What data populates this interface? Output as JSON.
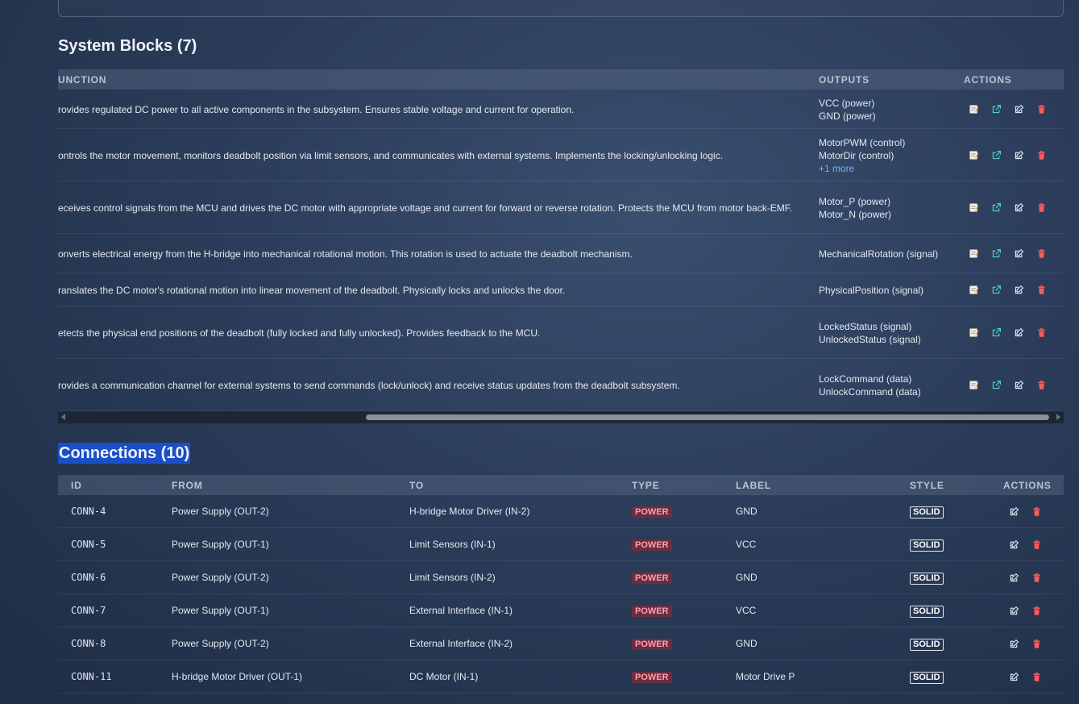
{
  "blocks": {
    "title": "System Blocks (7)",
    "headers": {
      "function": "UNCTION",
      "outputs": "OUTPUTS",
      "actions": "ACTIONS"
    },
    "rows": [
      {
        "function": "rovides regulated DC power to all active components in the subsystem. Ensures stable voltage and current for operation.",
        "outputs": [
          "VCC (power)",
          "GND (power)"
        ],
        "more": ""
      },
      {
        "function": "ontrols the motor movement, monitors deadbolt position via limit sensors, and communicates with external systems. Implements the locking/unlocking logic.",
        "outputs": [
          "MotorPWM (control)",
          "MotorDir (control)"
        ],
        "more": "+1 more"
      },
      {
        "function": "eceives control signals from the MCU and drives the DC motor with appropriate voltage and current for forward or reverse rotation. Protects the MCU from motor back-EMF.",
        "outputs": [
          "Motor_P (power)",
          "Motor_N (power)"
        ],
        "more": ""
      },
      {
        "function": "onverts electrical energy from the H-bridge into mechanical rotational motion. This rotation is used to actuate the deadbolt mechanism.",
        "outputs": [
          "MechanicalRotation (signal)"
        ],
        "more": ""
      },
      {
        "function": "ranslates the DC motor's rotational motion into linear movement of the deadbolt. Physically locks and unlocks the door.",
        "outputs": [
          "PhysicalPosition (signal)"
        ],
        "more": ""
      },
      {
        "function": "etects the physical end positions of the deadbolt (fully locked and fully unlocked). Provides feedback to the MCU.",
        "outputs": [
          "LockedStatus (signal)",
          "UnlockedStatus (signal)"
        ],
        "more": ""
      },
      {
        "function": "rovides a communication channel for external systems to send commands (lock/unlock) and receive status updates from the deadbolt subsystem.",
        "outputs": [
          "LockCommand (data)",
          "UnlockCommand (data)"
        ],
        "more": ""
      }
    ]
  },
  "connections": {
    "title": "Connections (10)",
    "headers": {
      "id": "ID",
      "from": "FROM",
      "to": "TO",
      "type": "TYPE",
      "label": "LABEL",
      "style": "STYLE",
      "actions": "ACTIONS"
    },
    "rows": [
      {
        "id": "CONN-4",
        "from": "Power Supply (OUT-2)",
        "to": "H-bridge Motor Driver (IN-2)",
        "type": "POWER",
        "label": "GND",
        "style": "SOLID"
      },
      {
        "id": "CONN-5",
        "from": "Power Supply (OUT-1)",
        "to": "Limit Sensors (IN-1)",
        "type": "POWER",
        "label": "VCC",
        "style": "SOLID"
      },
      {
        "id": "CONN-6",
        "from": "Power Supply (OUT-2)",
        "to": "Limit Sensors (IN-2)",
        "type": "POWER",
        "label": "GND",
        "style": "SOLID"
      },
      {
        "id": "CONN-7",
        "from": "Power Supply (OUT-1)",
        "to": "External Interface (IN-1)",
        "type": "POWER",
        "label": "VCC",
        "style": "SOLID"
      },
      {
        "id": "CONN-8",
        "from": "Power Supply (OUT-2)",
        "to": "External Interface (IN-2)",
        "type": "POWER",
        "label": "GND",
        "style": "SOLID"
      },
      {
        "id": "CONN-11",
        "from": "H-bridge Motor Driver (OUT-1)",
        "to": "DC Motor (IN-1)",
        "type": "POWER",
        "label": "Motor Drive P",
        "style": "SOLID"
      }
    ]
  },
  "icons": {
    "notes": "notes-icon",
    "open": "external-link-icon",
    "edit": "edit-icon",
    "delete": "trash-icon"
  },
  "colors": {
    "accent_link": "#6fb0ff",
    "power_badge_bg": "#6a2f3f",
    "power_badge_fg": "#ff9eb0",
    "delete": "#ff5a5a",
    "open": "#4fd1c5",
    "selection": "#1a4fc7"
  }
}
